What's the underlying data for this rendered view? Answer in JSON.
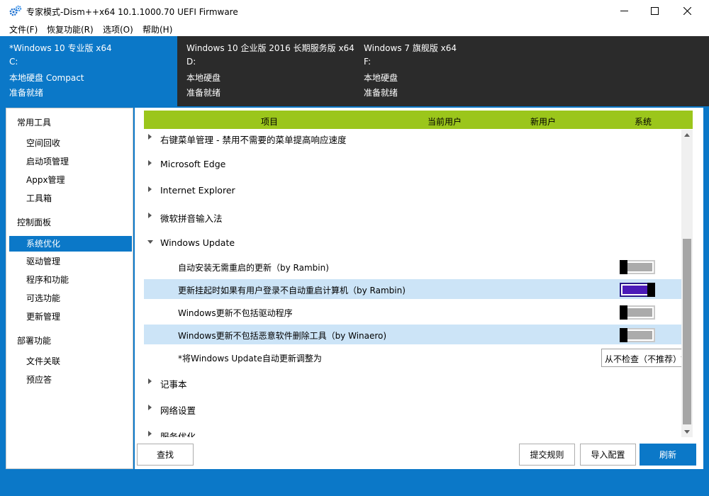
{
  "window": {
    "title": "专家模式-Dism++x64 10.1.1000.70 UEFI Firmware",
    "accent": "#0b78c8",
    "header_green": "#9bc61b"
  },
  "menu": {
    "items": [
      "文件(F)",
      "恢复功能(R)",
      "选项(O)",
      "帮助(H)"
    ]
  },
  "images": [
    {
      "name": "*Windows 10 专业版 x64",
      "drive": "C:",
      "disk": "本地硬盘 Compact",
      "status": "准备就绪",
      "active": true
    },
    {
      "name": "Windows 10 企业版 2016 长期服务版 x64",
      "drive": "D:",
      "disk": "本地硬盘",
      "status": "准备就绪",
      "active": false
    },
    {
      "name": "Windows 7 旗舰版 x64",
      "drive": "F:",
      "disk": "本地硬盘",
      "status": "准备就绪",
      "active": false
    }
  ],
  "sidebar": {
    "groups": [
      {
        "title": "常用工具",
        "items": [
          "空间回收",
          "启动项管理",
          "Appx管理",
          "工具箱"
        ]
      },
      {
        "title": "控制面板",
        "items": [
          "系统优化",
          "驱动管理",
          "程序和功能",
          "可选功能",
          "更新管理"
        ]
      },
      {
        "title": "部署功能",
        "items": [
          "文件关联",
          "预应答"
        ]
      }
    ],
    "selected": "系统优化"
  },
  "table": {
    "headers": {
      "item": "项目",
      "current_user": "当前用户",
      "new_user": "新用户",
      "system": "系统"
    }
  },
  "tree": {
    "categories_top": [
      "右键菜单管理 - 禁用不需要的菜单提高响应速度",
      "Microsoft Edge",
      "Internet Explorer",
      "微软拼音输入法"
    ],
    "expanded": "Windows Update",
    "options": [
      {
        "label": "自动安装无需重启的更新（by Rambin)",
        "on": false,
        "highlighted": false
      },
      {
        "label": "更新挂起时如果有用户登录不自动重启计算机（by Rambin)",
        "on": true,
        "highlighted": true
      },
      {
        "label": "Windows更新不包括驱动程序",
        "on": false,
        "highlighted": false
      },
      {
        "label": "Windows更新不包括恶意软件删除工具（by Winaero)",
        "on": false,
        "highlighted": true
      }
    ],
    "combo_option": {
      "label": "*将Windows Update自动更新调整为",
      "value": "从不检查（不推荐）"
    },
    "categories_bottom": [
      "记事本",
      "网络设置",
      "服务优化"
    ]
  },
  "buttons": {
    "find": "查找",
    "submit_rule": "提交规则",
    "import_config": "导入配置",
    "refresh": "刷新"
  }
}
